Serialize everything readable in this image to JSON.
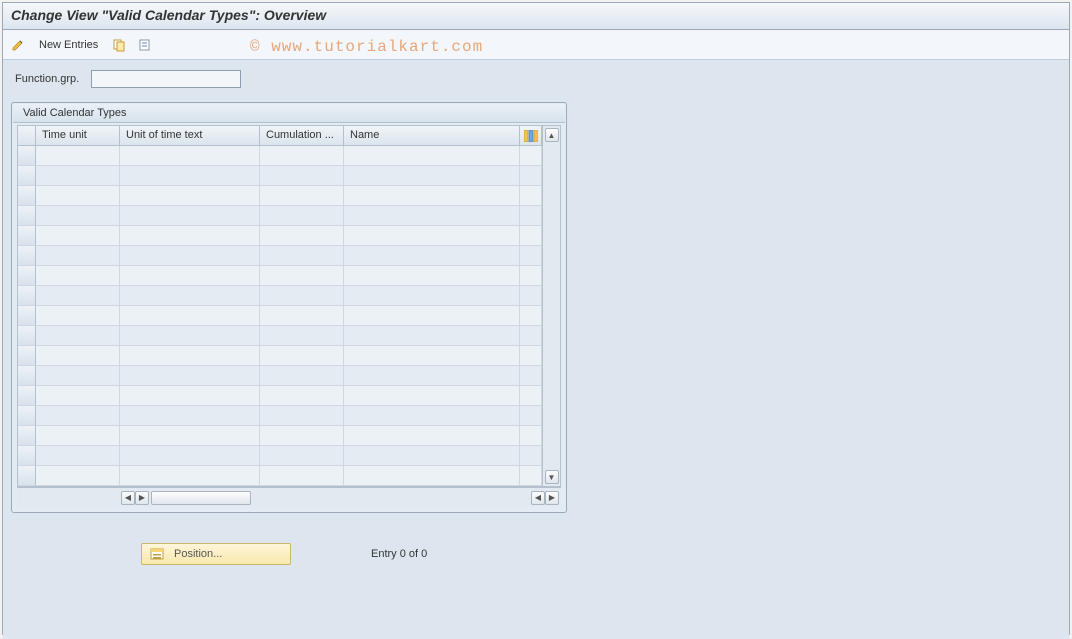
{
  "title": "Change View \"Valid Calendar Types\": Overview",
  "toolbar": {
    "new_entries": "New Entries"
  },
  "watermark": "© www.tutorialkart.com",
  "form": {
    "function_grp_label": "Function.grp.",
    "function_grp_value": ""
  },
  "panel": {
    "title": "Valid Calendar Types",
    "columns": [
      "Time unit",
      "Unit of time text",
      "Cumulation ...",
      "Name"
    ],
    "rows": 17
  },
  "footer": {
    "position_label": "Position...",
    "entry_text": "Entry 0 of 0"
  }
}
